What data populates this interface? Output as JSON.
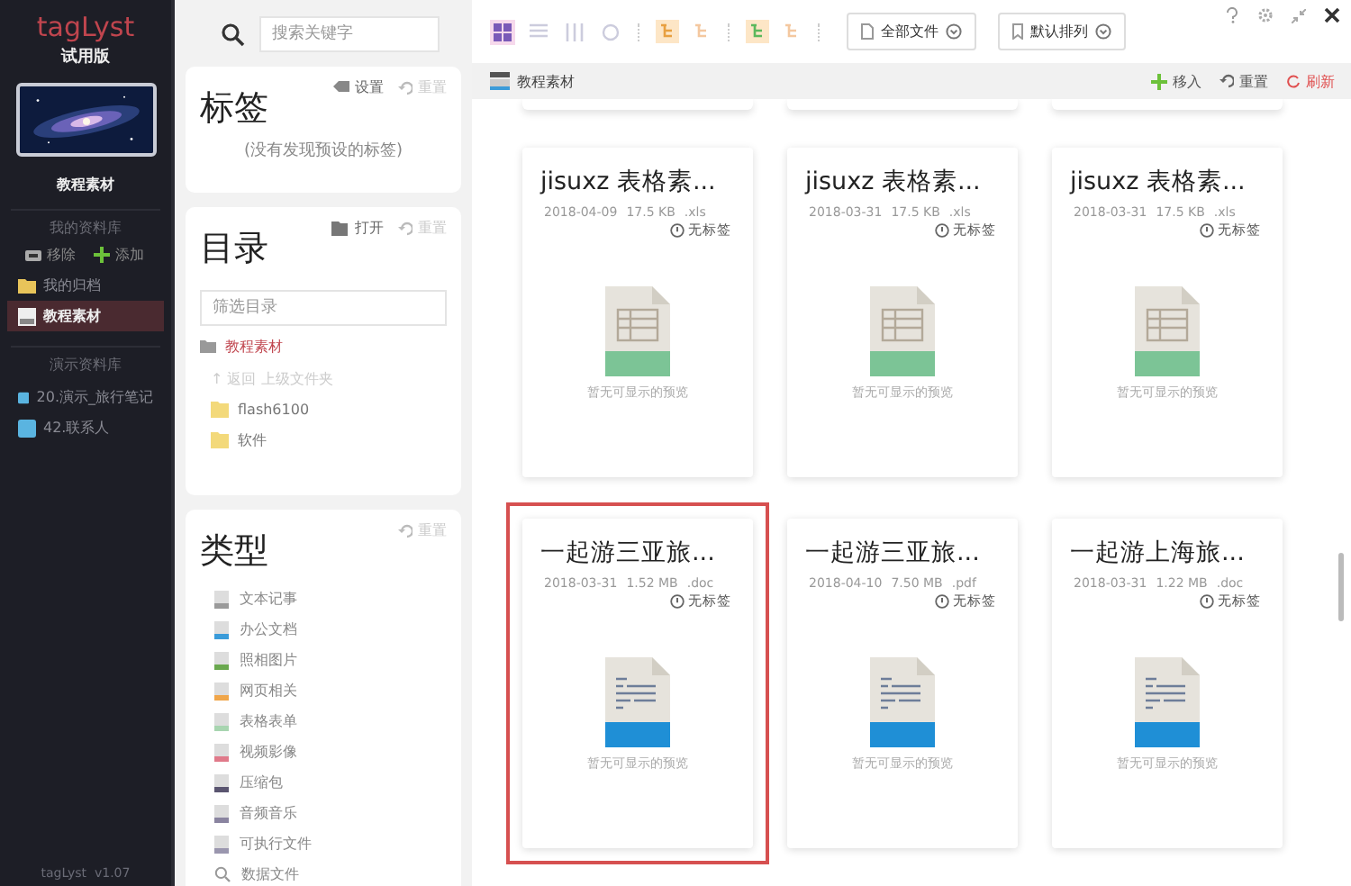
{
  "sidebar": {
    "app_name": "tagLyst",
    "edition": "试用版",
    "library_name": "教程素材",
    "my_libraries": {
      "heading": "我的资料库",
      "actions": [
        {
          "kind": "remove",
          "label": "移除"
        },
        {
          "kind": "add",
          "label": "添加"
        }
      ],
      "items": [
        {
          "label": "我的归档",
          "kind": "archive",
          "selected": false
        },
        {
          "label": "教程素材",
          "kind": "library",
          "selected": true
        }
      ]
    },
    "demo_libraries": {
      "heading": "演示资料库",
      "items": [
        {
          "label": "20.演示_旅行笔记",
          "selected": false
        },
        {
          "label": "42.联系人",
          "selected": false
        }
      ]
    },
    "footer": "tagLyst  v1.07"
  },
  "filters": {
    "search": {
      "placeholder": "搜索关键字"
    },
    "tags": {
      "title": "标签",
      "actions": [
        {
          "kind": "tag",
          "label": "设置",
          "disabled": false
        },
        {
          "kind": "reset",
          "label": "重置",
          "disabled": true
        }
      ],
      "empty": "(没有发现预设的标签)"
    },
    "folders": {
      "title": "目录",
      "actions": [
        {
          "kind": "open",
          "label": "打开",
          "disabled": false
        },
        {
          "kind": "reset",
          "label": "重置",
          "disabled": true
        }
      ],
      "filter": {
        "placeholder": "筛选目录"
      },
      "current": "教程素材",
      "up": "↑ 返回 上级文件夹",
      "items": [
        {
          "label": "flash6100"
        },
        {
          "label": "软件"
        }
      ]
    },
    "types": {
      "title": "类型",
      "actions": [
        {
          "kind": "reset",
          "label": "重置",
          "disabled": true
        }
      ],
      "items": [
        {
          "label": "文本记事",
          "kind": "file",
          "color": "#9a9a9a"
        },
        {
          "label": "办公文档",
          "kind": "file",
          "color": "#3a9bd9"
        },
        {
          "label": "照相图片",
          "kind": "file",
          "color": "#6aa84f"
        },
        {
          "label": "网页相关",
          "kind": "file",
          "color": "#f0a64a"
        },
        {
          "label": "表格表单",
          "kind": "file",
          "color": "#a8d5b0"
        },
        {
          "label": "视频影像",
          "kind": "file",
          "color": "#e07a8a"
        },
        {
          "label": "压缩包",
          "kind": "file",
          "color": "#5a5570"
        },
        {
          "label": "音频音乐",
          "kind": "file",
          "color": "#8a84a0"
        },
        {
          "label": "可执行文件",
          "kind": "file",
          "color": "#9a96ae"
        },
        {
          "label": "数据文件",
          "kind": "search"
        }
      ]
    }
  },
  "toolbar": {
    "views": [
      {
        "kind": "grid",
        "selected": true
      },
      {
        "kind": "list",
        "selected": false
      },
      {
        "kind": "columns",
        "selected": false
      },
      {
        "kind": "circle",
        "selected": false
      }
    ],
    "dropdowns": [
      {
        "kind": "file",
        "label": "全部文件"
      },
      {
        "kind": "sort",
        "label": "默认排列"
      }
    ]
  },
  "breadcrumb": {
    "label": "教程素材",
    "actions": [
      {
        "kind": "add",
        "label": "移入"
      },
      {
        "kind": "reset",
        "label": "重置"
      },
      {
        "kind": "refresh",
        "label": "刷新"
      }
    ]
  },
  "cards": [
    {
      "title": "jisuxz 表格素...",
      "date": "2018-04-09",
      "size": "17.5 KB",
      "ext": ".xls",
      "tag": "无标签",
      "kind": "xls",
      "caption": "暂无可显示的预览",
      "selected": false
    },
    {
      "title": "jisuxz 表格素...",
      "date": "2018-03-31",
      "size": "17.5 KB",
      "ext": ".xls",
      "tag": "无标签",
      "kind": "xls",
      "caption": "暂无可显示的预览",
      "selected": false
    },
    {
      "title": "jisuxz 表格素...",
      "date": "2018-03-31",
      "size": "17.5 KB",
      "ext": ".xls",
      "tag": "无标签",
      "kind": "xls",
      "caption": "暂无可显示的预览",
      "selected": false
    },
    {
      "title": "一起游三亚旅...",
      "date": "2018-03-31",
      "size": "1.52 MB",
      "ext": ".doc",
      "tag": "无标签",
      "kind": "doc",
      "caption": "暂无可显示的预览",
      "selected": true
    },
    {
      "title": "一起游三亚旅...",
      "date": "2018-04-10",
      "size": "7.50 MB",
      "ext": ".pdf",
      "tag": "无标签",
      "kind": "doc",
      "caption": "暂无可显示的预览",
      "selected": false
    },
    {
      "title": "一起游上海旅...",
      "date": "2018-03-31",
      "size": "1.22 MB",
      "ext": ".doc",
      "tag": "无标签",
      "kind": "doc",
      "caption": "暂无可显示的预览",
      "selected": false
    }
  ]
}
